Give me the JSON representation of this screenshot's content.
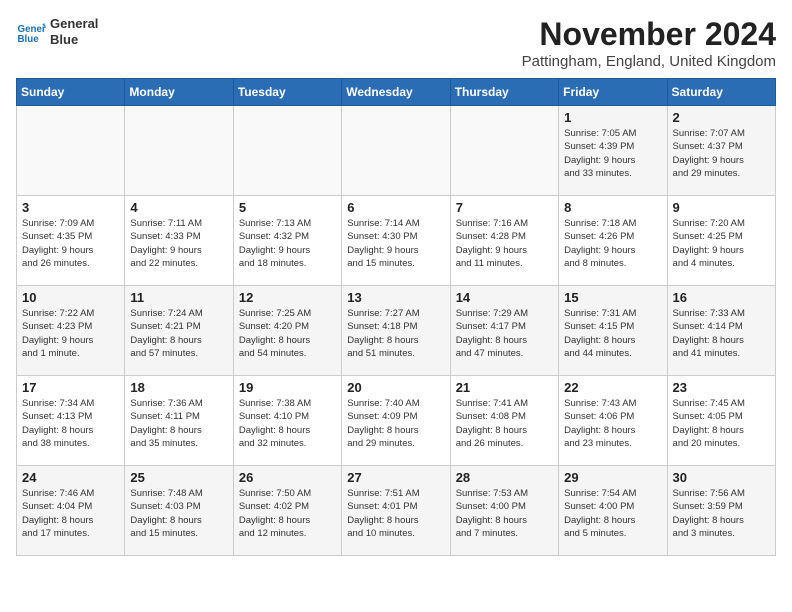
{
  "header": {
    "logo_line1": "General",
    "logo_line2": "Blue",
    "title": "November 2024",
    "subtitle": "Pattingham, England, United Kingdom"
  },
  "weekdays": [
    "Sunday",
    "Monday",
    "Tuesday",
    "Wednesday",
    "Thursday",
    "Friday",
    "Saturday"
  ],
  "weeks": [
    [
      {
        "day": "",
        "info": ""
      },
      {
        "day": "",
        "info": ""
      },
      {
        "day": "",
        "info": ""
      },
      {
        "day": "",
        "info": ""
      },
      {
        "day": "",
        "info": ""
      },
      {
        "day": "1",
        "info": "Sunrise: 7:05 AM\nSunset: 4:39 PM\nDaylight: 9 hours\nand 33 minutes."
      },
      {
        "day": "2",
        "info": "Sunrise: 7:07 AM\nSunset: 4:37 PM\nDaylight: 9 hours\nand 29 minutes."
      }
    ],
    [
      {
        "day": "3",
        "info": "Sunrise: 7:09 AM\nSunset: 4:35 PM\nDaylight: 9 hours\nand 26 minutes."
      },
      {
        "day": "4",
        "info": "Sunrise: 7:11 AM\nSunset: 4:33 PM\nDaylight: 9 hours\nand 22 minutes."
      },
      {
        "day": "5",
        "info": "Sunrise: 7:13 AM\nSunset: 4:32 PM\nDaylight: 9 hours\nand 18 minutes."
      },
      {
        "day": "6",
        "info": "Sunrise: 7:14 AM\nSunset: 4:30 PM\nDaylight: 9 hours\nand 15 minutes."
      },
      {
        "day": "7",
        "info": "Sunrise: 7:16 AM\nSunset: 4:28 PM\nDaylight: 9 hours\nand 11 minutes."
      },
      {
        "day": "8",
        "info": "Sunrise: 7:18 AM\nSunset: 4:26 PM\nDaylight: 9 hours\nand 8 minutes."
      },
      {
        "day": "9",
        "info": "Sunrise: 7:20 AM\nSunset: 4:25 PM\nDaylight: 9 hours\nand 4 minutes."
      }
    ],
    [
      {
        "day": "10",
        "info": "Sunrise: 7:22 AM\nSunset: 4:23 PM\nDaylight: 9 hours\nand 1 minute."
      },
      {
        "day": "11",
        "info": "Sunrise: 7:24 AM\nSunset: 4:21 PM\nDaylight: 8 hours\nand 57 minutes."
      },
      {
        "day": "12",
        "info": "Sunrise: 7:25 AM\nSunset: 4:20 PM\nDaylight: 8 hours\nand 54 minutes."
      },
      {
        "day": "13",
        "info": "Sunrise: 7:27 AM\nSunset: 4:18 PM\nDaylight: 8 hours\nand 51 minutes."
      },
      {
        "day": "14",
        "info": "Sunrise: 7:29 AM\nSunset: 4:17 PM\nDaylight: 8 hours\nand 47 minutes."
      },
      {
        "day": "15",
        "info": "Sunrise: 7:31 AM\nSunset: 4:15 PM\nDaylight: 8 hours\nand 44 minutes."
      },
      {
        "day": "16",
        "info": "Sunrise: 7:33 AM\nSunset: 4:14 PM\nDaylight: 8 hours\nand 41 minutes."
      }
    ],
    [
      {
        "day": "17",
        "info": "Sunrise: 7:34 AM\nSunset: 4:13 PM\nDaylight: 8 hours\nand 38 minutes."
      },
      {
        "day": "18",
        "info": "Sunrise: 7:36 AM\nSunset: 4:11 PM\nDaylight: 8 hours\nand 35 minutes."
      },
      {
        "day": "19",
        "info": "Sunrise: 7:38 AM\nSunset: 4:10 PM\nDaylight: 8 hours\nand 32 minutes."
      },
      {
        "day": "20",
        "info": "Sunrise: 7:40 AM\nSunset: 4:09 PM\nDaylight: 8 hours\nand 29 minutes."
      },
      {
        "day": "21",
        "info": "Sunrise: 7:41 AM\nSunset: 4:08 PM\nDaylight: 8 hours\nand 26 minutes."
      },
      {
        "day": "22",
        "info": "Sunrise: 7:43 AM\nSunset: 4:06 PM\nDaylight: 8 hours\nand 23 minutes."
      },
      {
        "day": "23",
        "info": "Sunrise: 7:45 AM\nSunset: 4:05 PM\nDaylight: 8 hours\nand 20 minutes."
      }
    ],
    [
      {
        "day": "24",
        "info": "Sunrise: 7:46 AM\nSunset: 4:04 PM\nDaylight: 8 hours\nand 17 minutes."
      },
      {
        "day": "25",
        "info": "Sunrise: 7:48 AM\nSunset: 4:03 PM\nDaylight: 8 hours\nand 15 minutes."
      },
      {
        "day": "26",
        "info": "Sunrise: 7:50 AM\nSunset: 4:02 PM\nDaylight: 8 hours\nand 12 minutes."
      },
      {
        "day": "27",
        "info": "Sunrise: 7:51 AM\nSunset: 4:01 PM\nDaylight: 8 hours\nand 10 minutes."
      },
      {
        "day": "28",
        "info": "Sunrise: 7:53 AM\nSunset: 4:00 PM\nDaylight: 8 hours\nand 7 minutes."
      },
      {
        "day": "29",
        "info": "Sunrise: 7:54 AM\nSunset: 4:00 PM\nDaylight: 8 hours\nand 5 minutes."
      },
      {
        "day": "30",
        "info": "Sunrise: 7:56 AM\nSunset: 3:59 PM\nDaylight: 8 hours\nand 3 minutes."
      }
    ]
  ]
}
